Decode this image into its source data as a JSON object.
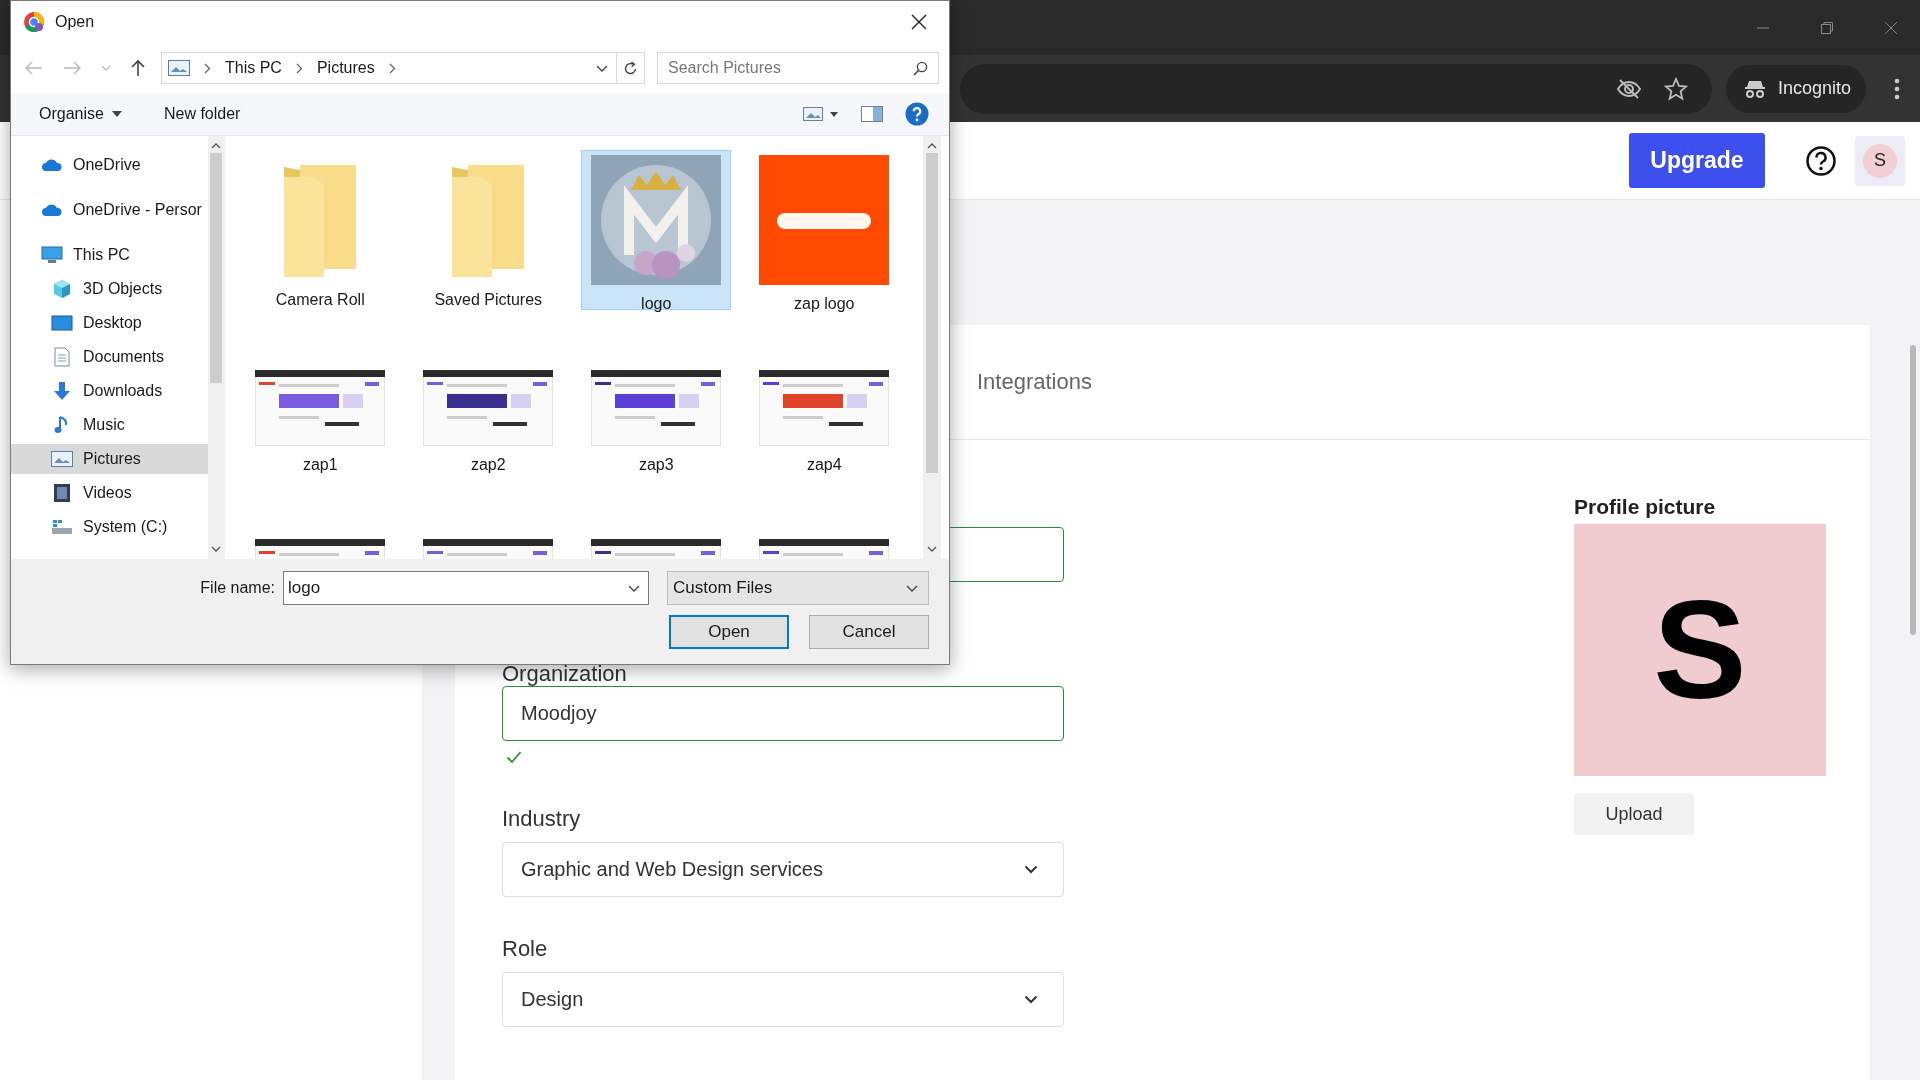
{
  "browser": {
    "incognito_label": "Incognito"
  },
  "header": {
    "upgrade_label": "Upgrade",
    "avatar_initial": "S"
  },
  "card": {
    "tab_label": "Integrations",
    "fields": [
      {
        "kind": "text",
        "valid": true
      },
      {
        "kind": "text",
        "label": "Organization",
        "value": "Moodjoy",
        "valid": true
      },
      {
        "kind": "select",
        "label": "Industry",
        "value": "Graphic and Web Design services"
      },
      {
        "kind": "select",
        "label": "Role",
        "value": "Design"
      }
    ],
    "profile": {
      "title": "Profile picture",
      "initial": "S",
      "upload_label": "Upload"
    }
  },
  "dialog": {
    "title": "Open",
    "path": [
      "This PC",
      "Pictures"
    ],
    "search_placeholder": "Search Pictures",
    "organise_label": "Organise",
    "new_folder_label": "New folder",
    "nav": [
      {
        "kind": "cloud",
        "label": "OneDrive",
        "selected": false
      },
      {
        "kind": "cloud",
        "label": "OneDrive - Persor",
        "selected": false
      },
      {
        "kind": "pc",
        "label": "This PC",
        "selected": false,
        "children": [
          {
            "kind": "cube",
            "label": "3D Objects",
            "selected": false
          },
          {
            "kind": "desktop",
            "label": "Desktop",
            "selected": false
          },
          {
            "kind": "document",
            "label": "Documents",
            "selected": false
          },
          {
            "kind": "download",
            "label": "Downloads",
            "selected": false
          },
          {
            "kind": "music",
            "label": "Music",
            "selected": false
          },
          {
            "kind": "pictures",
            "label": "Pictures",
            "selected": true
          },
          {
            "kind": "videos",
            "label": "Videos",
            "selected": false
          },
          {
            "kind": "drive",
            "label": "System (C:)",
            "selected": false
          }
        ]
      }
    ],
    "files": [
      {
        "kind": "folder",
        "name": "Camera Roll",
        "selected": false
      },
      {
        "kind": "folder",
        "name": "Saved Pictures",
        "selected": false
      },
      {
        "kind": "picture",
        "name": "logo",
        "selected": true
      },
      {
        "kind": "picture",
        "name": "zap logo",
        "selected": false
      },
      {
        "kind": "screenshot",
        "name": "zap1",
        "selected": false
      },
      {
        "kind": "screenshot",
        "name": "zap2",
        "selected": false
      },
      {
        "kind": "screenshot",
        "name": "zap3",
        "selected": false
      },
      {
        "kind": "screenshot",
        "name": "zap4",
        "selected": false
      },
      {
        "kind": "screenshot",
        "selected": false
      },
      {
        "kind": "screenshot",
        "selected": false
      },
      {
        "kind": "screenshot",
        "selected": false
      },
      {
        "kind": "screenshot",
        "selected": false
      }
    ],
    "file_name_label": "File name:",
    "file_name": "logo",
    "file_type": "Custom Files",
    "open_label": "Open",
    "cancel_label": "Cancel"
  }
}
